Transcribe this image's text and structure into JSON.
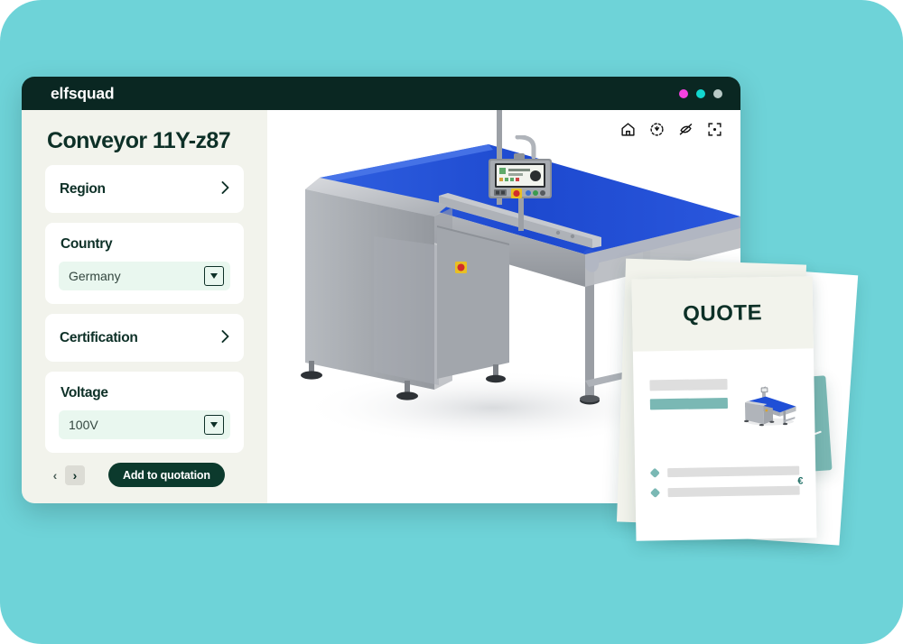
{
  "window": {
    "brand": "elfsquad",
    "dots": [
      "magenta",
      "cyan",
      "grey"
    ]
  },
  "sidebar": {
    "page_title": "Conveyor 11Y-z87",
    "options": [
      {
        "label": "Region",
        "state": "collapsed",
        "chevron": "chevron-right-icon"
      },
      {
        "label": "Country",
        "state": "expanded",
        "value": "Germany"
      },
      {
        "label": "Certification",
        "state": "collapsed",
        "chevron": "chevron-right-icon"
      },
      {
        "label": "Voltage",
        "state": "expanded",
        "value": "100V"
      }
    ],
    "footer": {
      "prev_label": "‹",
      "next_label": "›",
      "add_label": "Add to quotation"
    }
  },
  "viewer": {
    "tools": [
      {
        "name": "home-icon",
        "title": "Home view"
      },
      {
        "name": "orbit-icon",
        "title": "Orbit"
      },
      {
        "name": "hide-icon",
        "title": "Hide"
      },
      {
        "name": "focus-icon",
        "title": "Focus"
      }
    ],
    "model": "Conveyor belt 3D model"
  },
  "quote": {
    "title": "QUOTE",
    "currency_mark": "€",
    "thumbnail_alt": "conveyor thumbnail",
    "bullet_count": 2
  },
  "colors": {
    "backdrop": "#6ed3d8",
    "titlebar": "#0a2722",
    "sidebar_bg": "#f2f3ec",
    "accent_dark": "#0c3a2d",
    "select_bg": "#e9f7ef",
    "teal_card": "#7ab8b4",
    "belt_blue": "#1b4fd8",
    "dot_magenta": "#f442e0",
    "dot_cyan": "#12d7cf",
    "dot_grey": "#b8c9c6"
  }
}
